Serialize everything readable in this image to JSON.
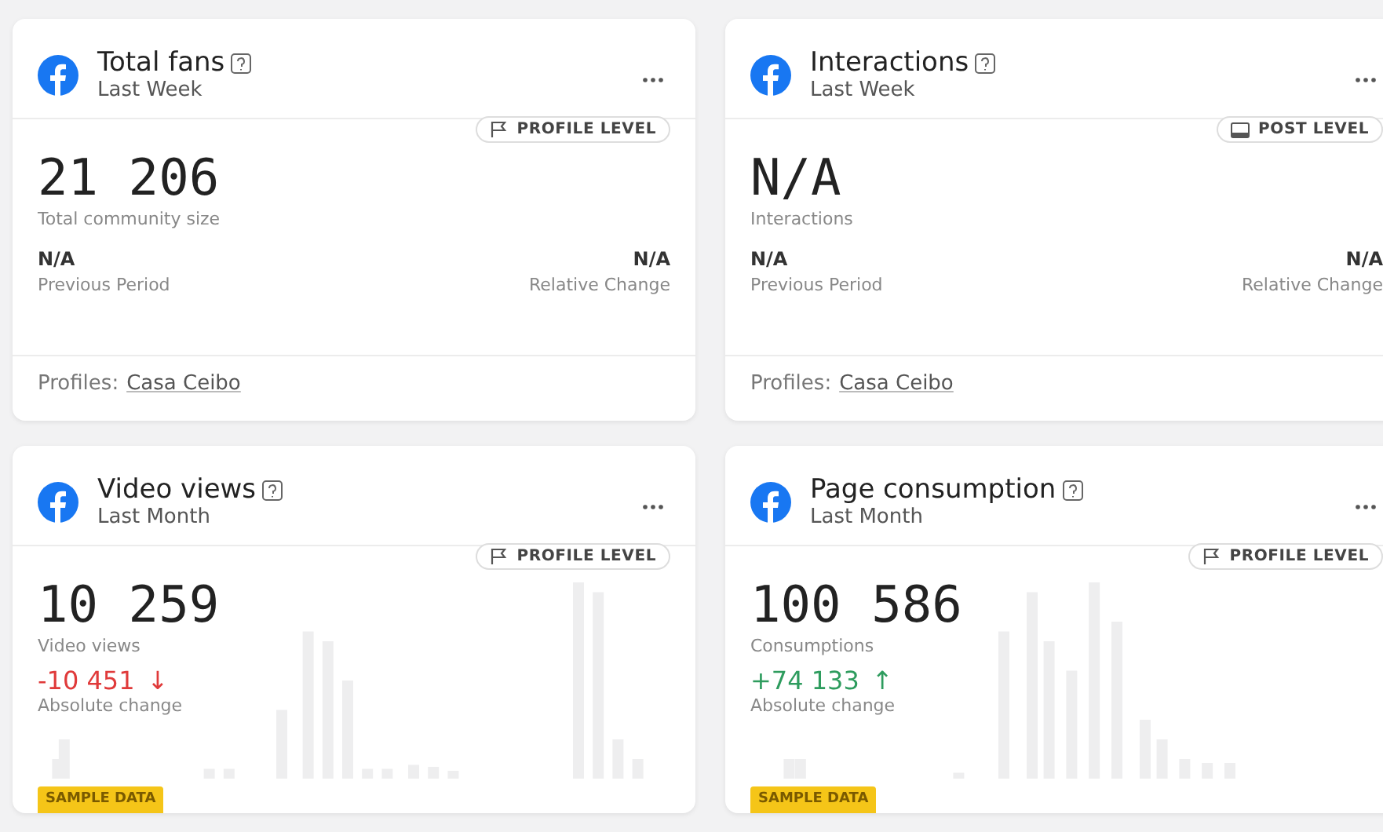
{
  "cards": [
    {
      "kind": "summary",
      "title": "Total fans",
      "period": "Last Week",
      "badge": {
        "kind": "profile",
        "label": "PROFILE LEVEL"
      },
      "value": "21 206",
      "value_label": "Total community size",
      "previous": {
        "value": "N/A",
        "label": "Previous Period"
      },
      "relative": {
        "value": "N/A",
        "label": "Relative Change"
      },
      "profiles_label": "Profiles:",
      "profile_name": "Casa Ceibo"
    },
    {
      "kind": "summary",
      "title": "Interactions",
      "period": "Last Week",
      "badge": {
        "kind": "post",
        "label": "POST LEVEL"
      },
      "value": "N/A",
      "value_label": "Interactions",
      "previous": {
        "value": "N/A",
        "label": "Previous Period"
      },
      "relative": {
        "value": "N/A",
        "label": "Relative Change"
      },
      "profiles_label": "Profiles:",
      "profile_name": "Casa Ceibo"
    },
    {
      "kind": "trend",
      "title": "Video views",
      "period": "Last Month",
      "badge": {
        "kind": "profile",
        "label": "PROFILE LEVEL"
      },
      "value": "10 259",
      "value_label": "Video views",
      "change": {
        "value": "-10 451",
        "arrow": "↓",
        "color": "#e03a3a"
      },
      "change_label": "Absolute change",
      "tag": "SAMPLE DATA"
    },
    {
      "kind": "trend",
      "title": "Page consumption",
      "period": "Last Month",
      "badge": {
        "kind": "profile",
        "label": "PROFILE LEVEL"
      },
      "value": "100 586",
      "value_label": "Consumptions",
      "change": {
        "value": "+74 133",
        "arrow": "↑",
        "color": "#2e9c5e"
      },
      "change_label": "Absolute change",
      "tag": "SAMPLE DATA"
    }
  ]
}
